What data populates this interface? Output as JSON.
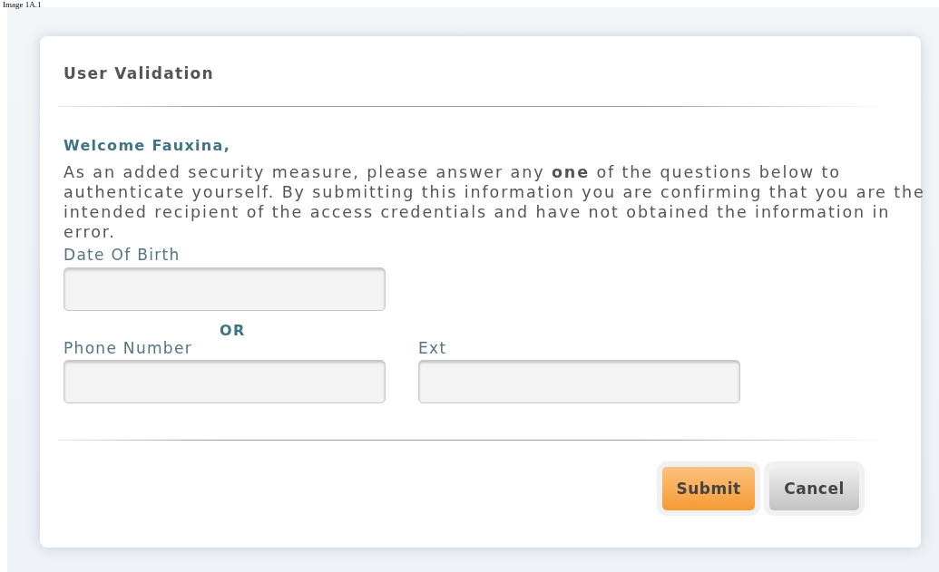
{
  "caption": "Image 1A.1",
  "dialog": {
    "title": "User Validation",
    "greeting": "Welcome Fauxina,",
    "message": "As an added security measure, please answer any **one** of the questions below to authenticate yourself. By submitting this information you are confirming that you are the intended recipient of the access credentials and have not obtained the information in error.",
    "fields": [
      {
        "label": "Date Of Birth"
      }
    ],
    "separator": "OR",
    "phone_fields": [
      {
        "label": "Phone Number"
      },
      {
        "label": "Ext"
      }
    ],
    "buttons": [
      {
        "label": "Submit",
        "kind": "primary"
      },
      {
        "label": "Cancel",
        "kind": "secondary"
      }
    ]
  }
}
